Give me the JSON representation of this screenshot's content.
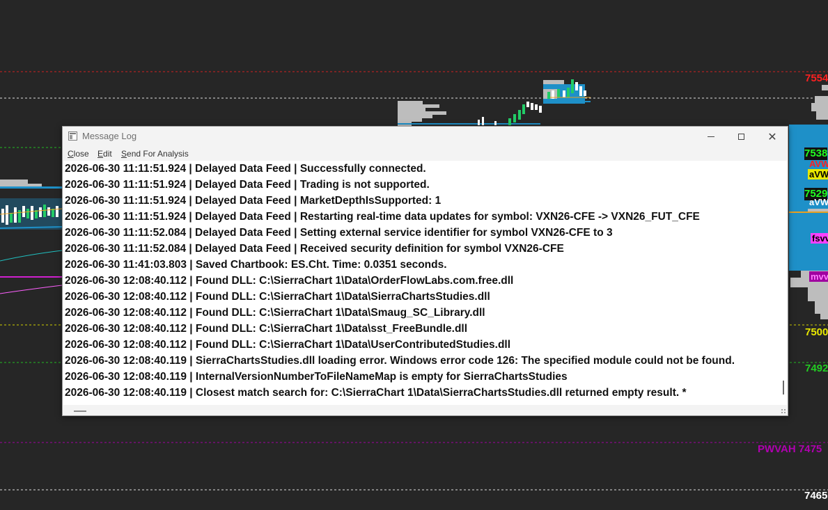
{
  "window": {
    "title": "Message Log",
    "menu": [
      {
        "label": "Close",
        "accel": "C",
        "rest": "lose"
      },
      {
        "label": "Edit",
        "accel": "E",
        "rest": "dit"
      },
      {
        "label": "Send For Analysis",
        "accel": "S",
        "rest": "end For Analysis"
      }
    ],
    "log_lines": [
      "2026-06-30  11:11:51.924 | Delayed Data Feed | Successfully connected.",
      "2026-06-30  11:11:51.924 | Delayed Data Feed | Trading is not supported.",
      "2026-06-30  11:11:51.924 | Delayed Data Feed | MarketDepthIsSupported: 1",
      "2026-06-30  11:11:51.924 | Delayed Data Feed | Restarting real-time data updates for symbol: VXN26-CFE -> VXN26_FUT_CFE",
      "2026-06-30  11:11:52.084 | Delayed Data Feed | Setting external service identifier for symbol VXN26-CFE to 3",
      "2026-06-30  11:11:52.084 | Delayed Data Feed | Received security definition for symbol VXN26-CFE",
      "2026-06-30  11:41:03.803 | Saved Chartbook: ES.Cht. Time: 0.0351 seconds.",
      "2026-06-30  12:08:40.112 | Found DLL: C:\\SierraChart 1\\Data\\OrderFlowLabs.com.free.dll",
      "2026-06-30  12:08:40.112 | Found DLL: C:\\SierraChart 1\\Data\\SierraChartsStudies.dll",
      "2026-06-30  12:08:40.112 | Found DLL: C:\\SierraChart 1\\Data\\Smaug_SC_Library.dll",
      "2026-06-30  12:08:40.112 | Found DLL: C:\\SierraChart 1\\Data\\sst_FreeBundle.dll",
      "2026-06-30  12:08:40.112 | Found DLL: C:\\SierraChart 1\\Data\\UserContributedStudies.dll",
      "2026-06-30  12:08:40.119 | SierraChartsStudies.dll loading error. Windows error code 126: The specified module could not be found.",
      "2026-06-30  12:08:40.119 | InternalVersionNumberToFileNameMap is empty for SierraChartsStudies",
      "2026-06-30  12:08:40.119 | Closest match search for: C:\\SierraChart 1\\Data\\SierraChartsStudies.dll returned empty result. *"
    ]
  },
  "chart": {
    "price_labels": [
      {
        "text": "7554",
        "color": "#ff2020"
      },
      {
        "text": "7538",
        "color": "#22ff22",
        "bg": "#111111"
      },
      {
        "text": "7529",
        "color": "#22ff22",
        "bg": "#111111"
      },
      {
        "text": "7500",
        "color": "#e8e800"
      },
      {
        "text": "7492",
        "color": "#22cc22"
      },
      {
        "text": "PWVAH  7475",
        "color": "#b000b0"
      },
      {
        "text": "7465",
        "color": "#ffffff"
      }
    ],
    "study_tags": [
      {
        "text": "AVW",
        "color": "#ff2020"
      },
      {
        "text": "aVW",
        "color": "#000000",
        "bg": "#e8e800"
      },
      {
        "text": "aVW",
        "color": "#ffffff",
        "bg": "#1e90c8"
      },
      {
        "text": "fsvv",
        "color": "#000000",
        "bg": "#ff40ff"
      },
      {
        "text": "mvv",
        "color": "#ff80ff",
        "bg": "#a000a0"
      }
    ]
  }
}
